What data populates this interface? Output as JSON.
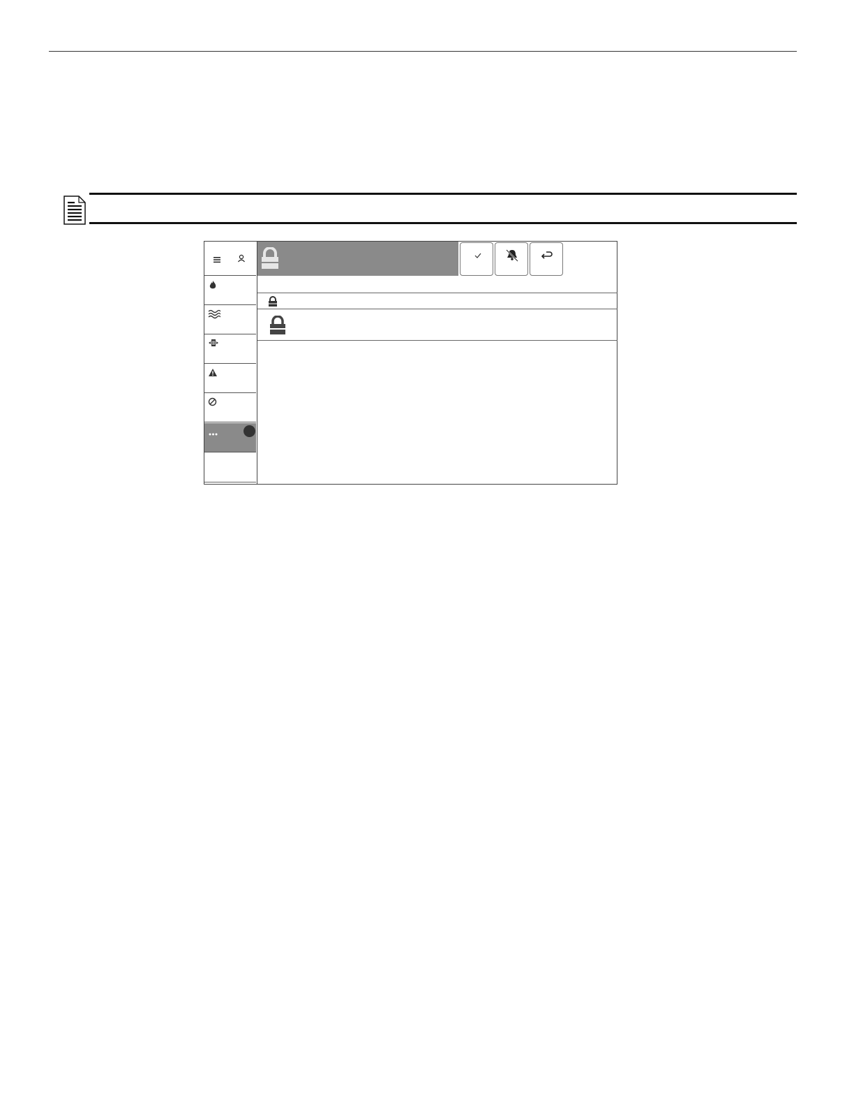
{
  "document": {
    "note_icon": "note-document-icon"
  },
  "panel": {
    "sidebar": {
      "top_icons": [
        "menu-icon",
        "user-icon"
      ],
      "items": [
        {
          "icon": "fire-icon",
          "active": false
        },
        {
          "icon": "waves-icon",
          "active": false
        },
        {
          "icon": "device-icon",
          "active": false
        },
        {
          "icon": "warning-icon",
          "active": false
        },
        {
          "icon": "disabled-icon",
          "active": false
        },
        {
          "icon": "more-icon",
          "active": true,
          "badge": true
        },
        {
          "icon": "",
          "active": false
        }
      ]
    },
    "banner": {
      "icon": "padlock-icon",
      "color": "#8a8a8a"
    },
    "toolbar": {
      "buttons": [
        "checkmark-icon",
        "silence-bell-icon",
        "back-arrow-icon"
      ]
    },
    "rows": [
      {
        "icon": "small-padlock-icon"
      },
      {
        "icon": "padlock-icon"
      }
    ]
  }
}
